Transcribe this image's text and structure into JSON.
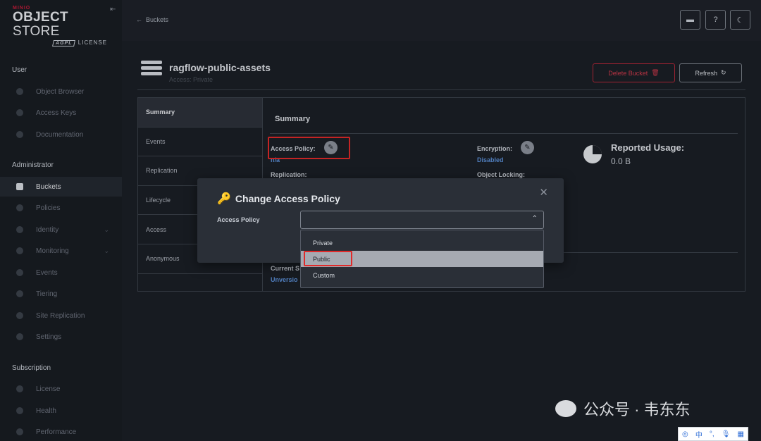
{
  "logo": {
    "brand": "MINIO",
    "product_bold": "OBJECT",
    "product_thin": "STORE",
    "agpl": "AGPL",
    "license": "LICENSE"
  },
  "sidebar": {
    "user_title": "User",
    "user_items": [
      {
        "label": "Object Browser"
      },
      {
        "label": "Access Keys"
      },
      {
        "label": "Documentation"
      }
    ],
    "admin_title": "Administrator",
    "admin_items": [
      {
        "label": "Buckets"
      },
      {
        "label": "Policies"
      },
      {
        "label": "Identity"
      },
      {
        "label": "Monitoring"
      },
      {
        "label": "Events"
      },
      {
        "label": "Tiering"
      },
      {
        "label": "Site Replication"
      },
      {
        "label": "Settings"
      }
    ],
    "sub_title": "Subscription",
    "sub_items": [
      {
        "label": "License"
      },
      {
        "label": "Health"
      },
      {
        "label": "Performance"
      }
    ],
    "active": "Buckets"
  },
  "topbar": {
    "back_label": "Buckets"
  },
  "bucket": {
    "name": "ragflow-public-assets",
    "access_text": "Access: Private",
    "delete_label": "Delete Bucket",
    "refresh_label": "Refresh"
  },
  "tabs": [
    "Summary",
    "Events",
    "Replication",
    "Lifecycle",
    "Access",
    "Anonymous"
  ],
  "summary": {
    "title": "Summary",
    "access_policy_label": "Access Policy:",
    "access_policy_value": "n/a",
    "replication_label": "Replication:",
    "encryption_label": "Encryption:",
    "encryption_value": "Disabled",
    "object_locking_label": "Object Locking:",
    "current_label": "Current S",
    "current_value": "Unversio",
    "usage_title": "Reported Usage:",
    "usage_value": "0.0 B"
  },
  "modal": {
    "title": "Change Access Policy",
    "field_label": "Access Policy",
    "options": [
      "Private",
      "Public",
      "Custom"
    ],
    "highlighted": "Public"
  },
  "watermark": {
    "text": "公众号 · 韦东东"
  },
  "ime": {
    "lang": "中"
  },
  "colors": {
    "accent_red": "#c51b3a",
    "link_blue": "#5b8fd6",
    "annotation_red": "#e02a2a"
  }
}
